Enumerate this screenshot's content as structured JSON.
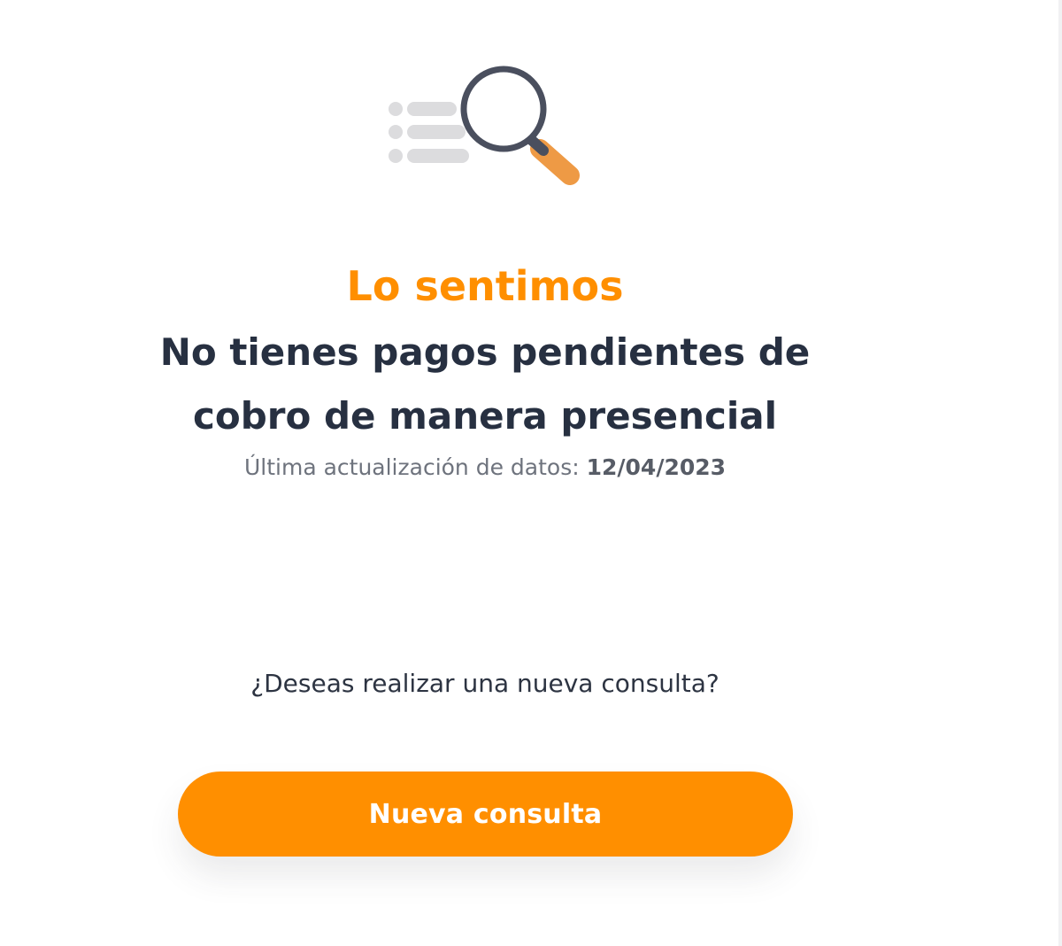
{
  "illustration": {
    "icon": "search-list-icon",
    "accent_color": "#EE9A45",
    "lens_color": "#4A4F5E",
    "list_color": "#DCDCDE"
  },
  "message": {
    "title": "Lo sentimos",
    "headline": "No tienes pagos pendientes de cobro de manera presencial",
    "update_label": "Última actualización de datos:",
    "update_date": "12/04/2023"
  },
  "prompt": {
    "question": "¿Deseas realizar una nueva consulta?"
  },
  "actions": {
    "new_query_label": "Nueva consulta"
  },
  "colors": {
    "brand_orange": "#FF8F00",
    "text_dark": "#273041",
    "text_muted": "#6E737D"
  }
}
